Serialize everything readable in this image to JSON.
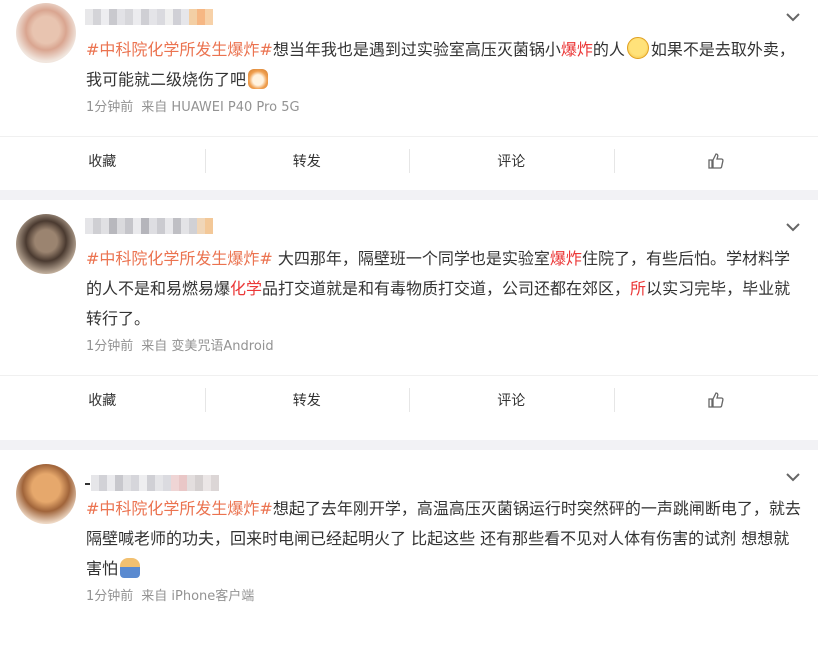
{
  "posts": [
    {
      "content": [
        {
          "t": "topic",
          "v": "#中科院化学所发生爆炸#"
        },
        {
          "t": "text",
          "v": "想当年我也是遇到过实验室高压灭菌锅小"
        },
        {
          "t": "hl",
          "v": "爆炸"
        },
        {
          "t": "text",
          "v": "的人"
        },
        {
          "t": "emoji",
          "v": "shy-face"
        },
        {
          "t": "text",
          "v": "如果不是去取外卖，我可能就二级烧伤了吧"
        },
        {
          "t": "emoji",
          "v": "cat-face"
        }
      ],
      "time": "1分钟前",
      "from": "来自 HUAWEI P40 Pro 5G"
    },
    {
      "content": [
        {
          "t": "topic",
          "v": "#中科院化学所发生爆炸#"
        },
        {
          "t": "text",
          "v": " 大四那年，隔壁班一个同学也是实验室"
        },
        {
          "t": "hl",
          "v": "爆炸"
        },
        {
          "t": "text",
          "v": "住院了，有些后怕。学材料学的人不是和易燃易爆"
        },
        {
          "t": "hl",
          "v": "化学"
        },
        {
          "t": "text",
          "v": "品打交道就是和有毒物质打交道，公司还都在郊区，"
        },
        {
          "t": "hl",
          "v": "所"
        },
        {
          "t": "text",
          "v": "以实习完毕，毕业就转行了。"
        }
      ],
      "time": "1分钟前",
      "from": "来自 变美咒语Android"
    },
    {
      "content": [
        {
          "t": "topic",
          "v": "#中科院化学所发生爆炸#"
        },
        {
          "t": "text",
          "v": "想起了去年刚开学，高温高压灭菌锅运行时突然砰的一声跳闸断电了，就去隔壁喊老师的功夫，回来时电闸已经起明火了 比起这些 还有那些看不见对人体有伤害的试剂 想想就害怕"
        },
        {
          "t": "emoji",
          "v": "person-emoji"
        }
      ],
      "time": "1分钟前",
      "from": "来自 iPhone客户端"
    }
  ],
  "actions": {
    "favorite": "收藏",
    "repost": "转发",
    "comment": "评论"
  },
  "colors": {
    "topic": "#eb7350",
    "highlight": "#eb3737",
    "meta": "#939393"
  }
}
